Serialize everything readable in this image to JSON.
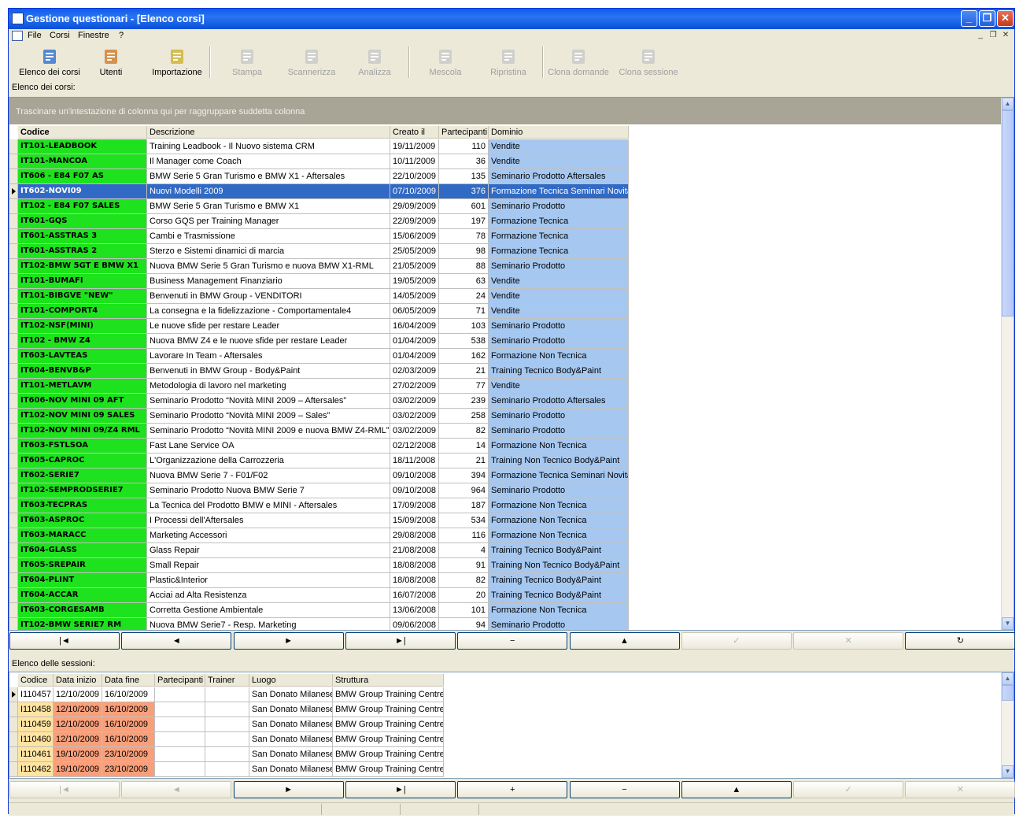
{
  "window": {
    "title": "Gestione questionari - [Elenco corsi]"
  },
  "menu": [
    "File",
    "Corsi",
    "Finestre",
    "?"
  ],
  "toolbar": [
    {
      "label": "Elenco dei corsi",
      "icon": "course-tree-icon",
      "enabled": true
    },
    {
      "label": "Utenti",
      "icon": "users-icon",
      "enabled": true
    },
    {
      "label": "Importazione",
      "icon": "import-folder-icon",
      "enabled": true
    },
    {
      "label": "Stampa",
      "icon": "printer-icon",
      "enabled": false
    },
    {
      "label": "Scannerizza",
      "icon": "scanner-icon",
      "enabled": false
    },
    {
      "label": "Analizza",
      "icon": "analyze-icon",
      "enabled": false
    },
    {
      "label": "Mescola",
      "icon": "shuffle-icon",
      "enabled": false
    },
    {
      "label": "Ripristina",
      "icon": "restore-icon",
      "enabled": false
    },
    {
      "label": "Clona domande",
      "icon": "clone-questions-icon",
      "enabled": false
    },
    {
      "label": "Clona sessione",
      "icon": "clone-session-icon",
      "enabled": false
    }
  ],
  "courses_label": "Elenco dei corsi:",
  "group_hint": "Trascinare un'intestazione di colonna qui per raggruppare suddetta colonna",
  "courses_columns": [
    "Codice",
    "Descrizione",
    "Creato il",
    "Partecipanti",
    "Dominio"
  ],
  "courses": [
    [
      "IT101-LEADBOOK",
      "Training Leadbook - Il Nuovo sistema CRM",
      "19/11/2009",
      "110",
      "Vendite"
    ],
    [
      "IT101-MANCOA",
      "Il Manager come Coach",
      "10/11/2009",
      "36",
      "Vendite"
    ],
    [
      "IT606 - E84 F07 AS",
      "BMW Serie 5 Gran Turismo e BMW X1 - Aftersales",
      "22/10/2009",
      "135",
      "Seminario Prodotto Aftersales"
    ],
    [
      "IT602-NOVI09",
      "Nuovi Modelli 2009",
      "07/10/2009",
      "376",
      "Formazione Tecnica Seminari Novità"
    ],
    [
      "IT102 - E84 F07 SALES",
      "BMW Serie 5 Gran Turismo e BMW X1",
      "29/09/2009",
      "601",
      "Seminario Prodotto"
    ],
    [
      "IT601-GQS",
      "Corso GQS per Training Manager",
      "22/09/2009",
      "197",
      "Formazione Tecnica"
    ],
    [
      "IT601-ASSTRAS 3",
      "Cambi e Trasmissione",
      "15/06/2009",
      "78",
      "Formazione Tecnica"
    ],
    [
      "IT601-ASSTRAS 2",
      "Sterzo e Sistemi dinamici di marcia",
      "25/05/2009",
      "98",
      "Formazione Tecnica"
    ],
    [
      "IT102-BMW 5GT E BMW X1",
      "Nuova BMW Serie 5 Gran Turismo e nuova BMW X1-RML",
      "21/05/2009",
      "88",
      "Seminario Prodotto"
    ],
    [
      "IT101-BUMAFI",
      "Business Management Finanziario",
      "19/05/2009",
      "63",
      "Vendite"
    ],
    [
      "IT101-BIBGVE \"NEW\"",
      "Benvenuti in BMW Group - VENDITORI",
      "14/05/2009",
      "24",
      "Vendite"
    ],
    [
      "IT101-COMPORT4",
      "La consegna e la fidelizzazione - Comportamentale4",
      "06/05/2009",
      "71",
      "Vendite"
    ],
    [
      "IT102-NSF(MINI)",
      "Le nuove sfide per restare Leader",
      "16/04/2009",
      "103",
      "Seminario Prodotto"
    ],
    [
      "IT102 - BMW Z4",
      "Nuova BMW Z4 e le nuove sfide per restare Leader",
      "01/04/2009",
      "538",
      "Seminario Prodotto"
    ],
    [
      "IT603-LAVTEAS",
      "Lavorare In Team - Aftersales",
      "01/04/2009",
      "162",
      "Formazione Non Tecnica"
    ],
    [
      "IT604-BENVB&P",
      "Benvenuti in BMW Group - Body&Paint",
      "02/03/2009",
      "21",
      "Training Tecnico Body&Paint"
    ],
    [
      "IT101-METLAVM",
      "Metodologia di lavoro nel marketing",
      "27/02/2009",
      "77",
      "Vendite"
    ],
    [
      "IT606-NOV MINI 09 AFT",
      "Seminario Prodotto “Novità MINI 2009 – Aftersales”",
      "03/02/2009",
      "239",
      "Seminario Prodotto Aftersales"
    ],
    [
      "IT102-NOV MINI 09 SALES",
      "Seminario Prodotto “Novità MINI 2009 – Sales”",
      "03/02/2009",
      "258",
      "Seminario Prodotto"
    ],
    [
      "IT102-NOV MINI 09/Z4 RML",
      "Seminario Prodotto “Novità MINI 2009 e nuova BMW Z4-RML”",
      "03/02/2009",
      "82",
      "Seminario Prodotto"
    ],
    [
      "IT603-FSTLSOA",
      "Fast Lane Service OA",
      "02/12/2008",
      "14",
      "Formazione Non Tecnica"
    ],
    [
      "IT605-CAPROC",
      "L'Organizzazione della Carrozzeria",
      "18/11/2008",
      "21",
      "Training Non Tecnico Body&Paint"
    ],
    [
      "IT602-SERIE7",
      "Nuova BMW Serie 7 - F01/F02",
      "09/10/2008",
      "394",
      "Formazione Tecnica Seminari Novità"
    ],
    [
      "IT102-SEMPRODSERIE7",
      "Seminario Prodotto Nuova BMW Serie 7",
      "09/10/2008",
      "964",
      "Seminario Prodotto"
    ],
    [
      "IT603-TECPRAS",
      "La Tecnica del Prodotto BMW e MINI - Aftersales",
      "17/09/2008",
      "187",
      "Formazione Non Tecnica"
    ],
    [
      "IT603-ASPROC",
      "I Processi dell'Aftersales",
      "15/09/2008",
      "534",
      "Formazione Non Tecnica"
    ],
    [
      "IT603-MARACC",
      "Marketing Accessori",
      "29/08/2008",
      "116",
      "Formazione Non Tecnica"
    ],
    [
      "IT604-GLASS",
      "Glass Repair",
      "21/08/2008",
      "4",
      "Training Tecnico Body&Paint"
    ],
    [
      "IT605-SREPAIR",
      "Small Repair",
      "18/08/2008",
      "91",
      "Training Non Tecnico Body&Paint"
    ],
    [
      "IT604-PLINT",
      "Plastic&Interior",
      "18/08/2008",
      "82",
      "Training Tecnico Body&Paint"
    ],
    [
      "IT604-ACCAR",
      "Acciai ad Alta Resistenza",
      "16/07/2008",
      "20",
      "Training Tecnico Body&Paint"
    ],
    [
      "IT603-CORGESAMB",
      "Corretta Gestione Ambientale",
      "13/06/2008",
      "101",
      "Formazione Non Tecnica"
    ],
    [
      "IT102-BMW SERIE7 RM",
      "Nuova BMW Serie7 - Resp. Marketing",
      "09/06/2008",
      "94",
      "Seminario Prodotto"
    ]
  ],
  "courses_selected_index": 3,
  "courses_nav": [
    "|◄",
    "◄",
    "►",
    "►|",
    "−",
    "▲",
    "✓",
    "✕",
    "↻"
  ],
  "courses_nav_enabled": [
    true,
    true,
    true,
    true,
    true,
    true,
    false,
    false,
    true
  ],
  "sessions_label": "Elenco delle sessioni:",
  "sessions_columns": [
    "Codice",
    "Data inizio",
    "Data fine",
    "Partecipanti",
    "Trainer",
    "Luogo",
    "Struttura"
  ],
  "sessions": [
    [
      "I110457",
      "12/10/2009",
      "16/10/2009",
      "",
      "",
      "San Donato Milanese",
      "BMW Group Training Centre"
    ],
    [
      "I110458",
      "12/10/2009",
      "16/10/2009",
      "",
      "",
      "San Donato Milanese",
      "BMW Group Training Centre"
    ],
    [
      "I110459",
      "12/10/2009",
      "16/10/2009",
      "",
      "",
      "San Donato Milanese",
      "BMW Group Training Centre"
    ],
    [
      "I110460",
      "12/10/2009",
      "16/10/2009",
      "",
      "",
      "San Donato Milanese",
      "BMW Group Training Centre"
    ],
    [
      "I110461",
      "19/10/2009",
      "23/10/2009",
      "",
      "",
      "San Donato Milanese",
      "BMW Group Training Centre"
    ],
    [
      "I110462",
      "19/10/2009",
      "23/10/2009",
      "",
      "",
      "San Donato Milanese",
      "BMW Group Training Centre"
    ]
  ],
  "sessions_selected_index": 0,
  "sessions_nav": [
    "|◄",
    "◄",
    "►",
    "►|",
    "+",
    "−",
    "▲",
    "✓",
    "✕"
  ],
  "sessions_nav_enabled": [
    false,
    false,
    true,
    true,
    true,
    true,
    true,
    false,
    false
  ]
}
